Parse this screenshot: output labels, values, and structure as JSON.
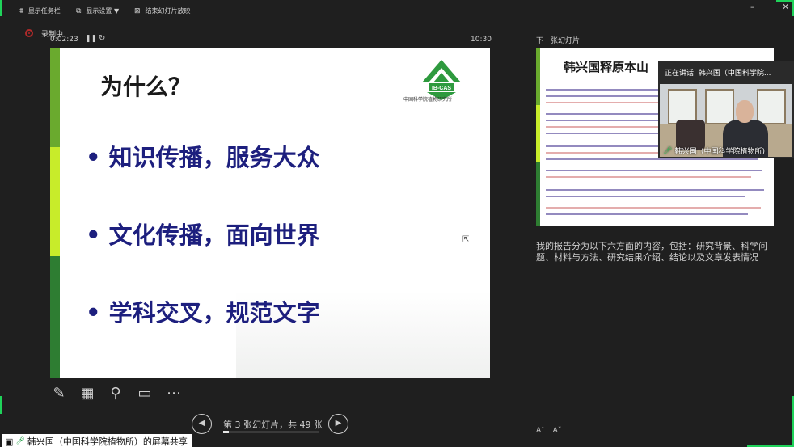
{
  "toolbar": {
    "show_taskbar": "显示任务栏",
    "display_settings": "显示设置 ▼",
    "end_show": "结束幻灯片放映"
  },
  "recording": {
    "label": "录制中",
    "elapsed": "0:02:23",
    "clock": "10:30"
  },
  "slide": {
    "title": "为什么？",
    "bullets": [
      "知识传播，服务大众",
      "文化传播，面向世界",
      "学科交叉，规范文字"
    ],
    "logo_abbr": "IB-CAS",
    "logo_caption": "中国科学院植物研究所"
  },
  "navigation": {
    "slide_label": "第 3 张幻灯片，共 49 张",
    "current": 3,
    "total": 49
  },
  "next_panel": {
    "label": "下一张幻灯片",
    "title": "韩兴国释原本山"
  },
  "notes": {
    "text": "我的报告分为以下六方面的内容，包括：研究背景、科学问题、材料与方法、研究结果介绍、结论以及文章发表情况"
  },
  "font_buttons": [
    "A˄",
    "A˅"
  ],
  "speaker": {
    "header": "正在讲话: 韩兴国（中国科学院...",
    "name": "韩兴国（中国科学院植物所)"
  },
  "share": {
    "label": "韩兴国（中国科学院植物所）的屏幕共享"
  },
  "colors": {
    "accent_green": "#1fd35a",
    "slide_text_blue": "#1d1f7e",
    "stripe_dark_green": "#2e7d32",
    "stripe_lime": "#a6d63c"
  }
}
